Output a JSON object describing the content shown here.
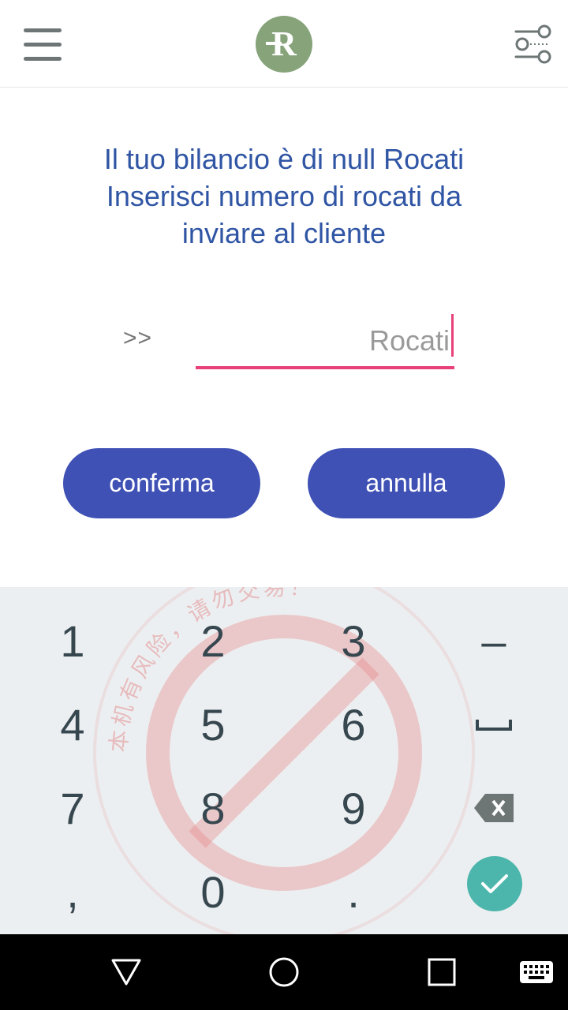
{
  "appbar": {
    "menu_icon": "hamburger-menu-icon",
    "logo_text": "R",
    "settings_icon": "filter-sliders-icon"
  },
  "message": {
    "line1": "Il tuo bilancio è di null Rocati",
    "line2": "Inserisci numero di rocati da",
    "line3": "inviare al cliente"
  },
  "input": {
    "prefix": ">>",
    "placeholder": "Rocati",
    "value": ""
  },
  "buttons": {
    "confirm": "conferma",
    "cancel": "annulla"
  },
  "keyboard": {
    "keys": [
      "1",
      "2",
      "3",
      "–",
      "4",
      "5",
      "6",
      "␣",
      "7",
      "8",
      "9",
      "⌫",
      ",",
      "0",
      ".",
      "✓"
    ],
    "k1": "1",
    "k2": "2",
    "k3": "3",
    "minus": "–",
    "k4": "4",
    "k5": "5",
    "k6": "6",
    "k7": "7",
    "k8": "8",
    "k9": "9",
    "comma": ",",
    "k0": "0",
    "dot": "."
  },
  "watermark": {
    "text": "本机有风险，请勿交易！"
  },
  "colors": {
    "primary_button": "#3f51b5",
    "accent": "#e8417a",
    "message": "#2f55a4",
    "logo": "#86a37a",
    "ok": "#4db6ac"
  }
}
